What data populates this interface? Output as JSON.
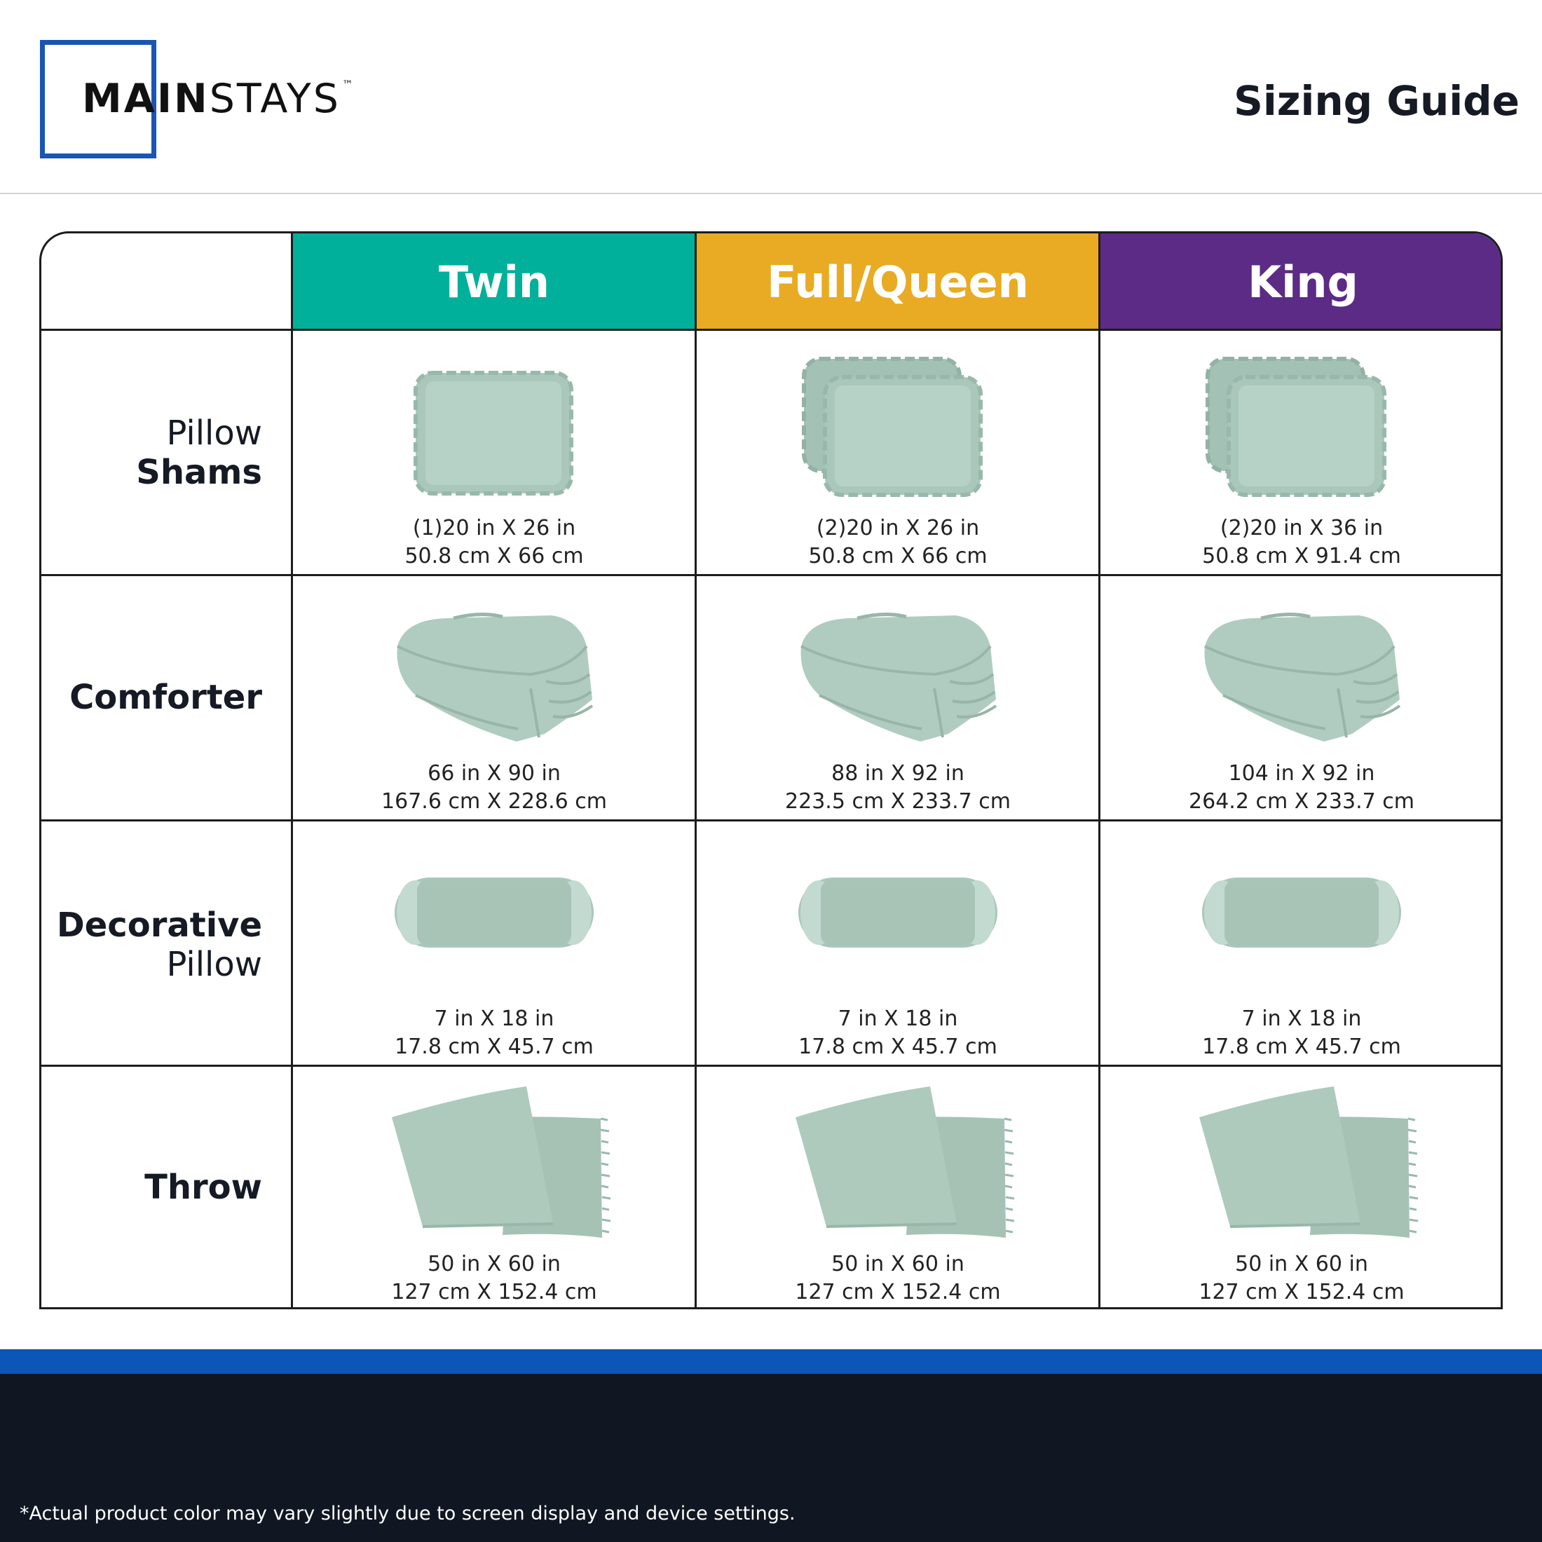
{
  "brand": {
    "name_bold": "MAIN",
    "name_light": "STAYS",
    "trademark": "™",
    "color": "#1a55b5"
  },
  "header": {
    "title": "Sizing Guide"
  },
  "table": {
    "columns": [
      {
        "label": "Twin",
        "color": "#00b09b"
      },
      {
        "label": "Full/Queen",
        "color": "#e8ab23"
      },
      {
        "label": "King",
        "color": "#5b2b85"
      }
    ],
    "rows": [
      {
        "label_top": "Pillow",
        "label_bottom": "Shams",
        "icon": "pillow-sham-icon",
        "cells": [
          {
            "line1": "(1)20 in X 26 in",
            "line2": "50.8 cm X 66 cm"
          },
          {
            "line1": "(2)20 in X 26 in",
            "line2": "50.8 cm X 66 cm"
          },
          {
            "line1": "(2)20 in X 36 in",
            "line2": "50.8 cm X 91.4 cm"
          }
        ]
      },
      {
        "label_top": "Comforter",
        "label_bottom": "",
        "icon": "comforter-icon",
        "cells": [
          {
            "line1": "66 in X 90 in",
            "line2": "167.6 cm X 228.6 cm"
          },
          {
            "line1": "88 in X 92 in",
            "line2": "223.5 cm X 233.7 cm"
          },
          {
            "line1": "104 in X 92 in",
            "line2": "264.2 cm X 233.7 cm"
          }
        ]
      },
      {
        "label_top": "Decorative",
        "label_bottom": "Pillow",
        "icon": "bolster-pillow-icon",
        "cells": [
          {
            "line1": "7 in X 18 in",
            "line2": "17.8 cm X 45.7 cm"
          },
          {
            "line1": "7 in X 18 in",
            "line2": "17.8 cm X 45.7 cm"
          },
          {
            "line1": "7 in X 18 in",
            "line2": "17.8 cm X 45.7 cm"
          }
        ]
      },
      {
        "label_top": "Throw",
        "label_bottom": "",
        "icon": "throw-blanket-icon",
        "cells": [
          {
            "line1": "50 in X 60 in",
            "line2": "127 cm X 152.4 cm"
          },
          {
            "line1": "50 in X 60 in",
            "line2": "127 cm X 152.4 cm"
          },
          {
            "line1": "50 in X 60 in",
            "line2": "127 cm X 152.4 cm"
          }
        ]
      }
    ]
  },
  "footer": {
    "disclaimer": "*Actual product color may vary slightly due to screen display and device settings."
  }
}
